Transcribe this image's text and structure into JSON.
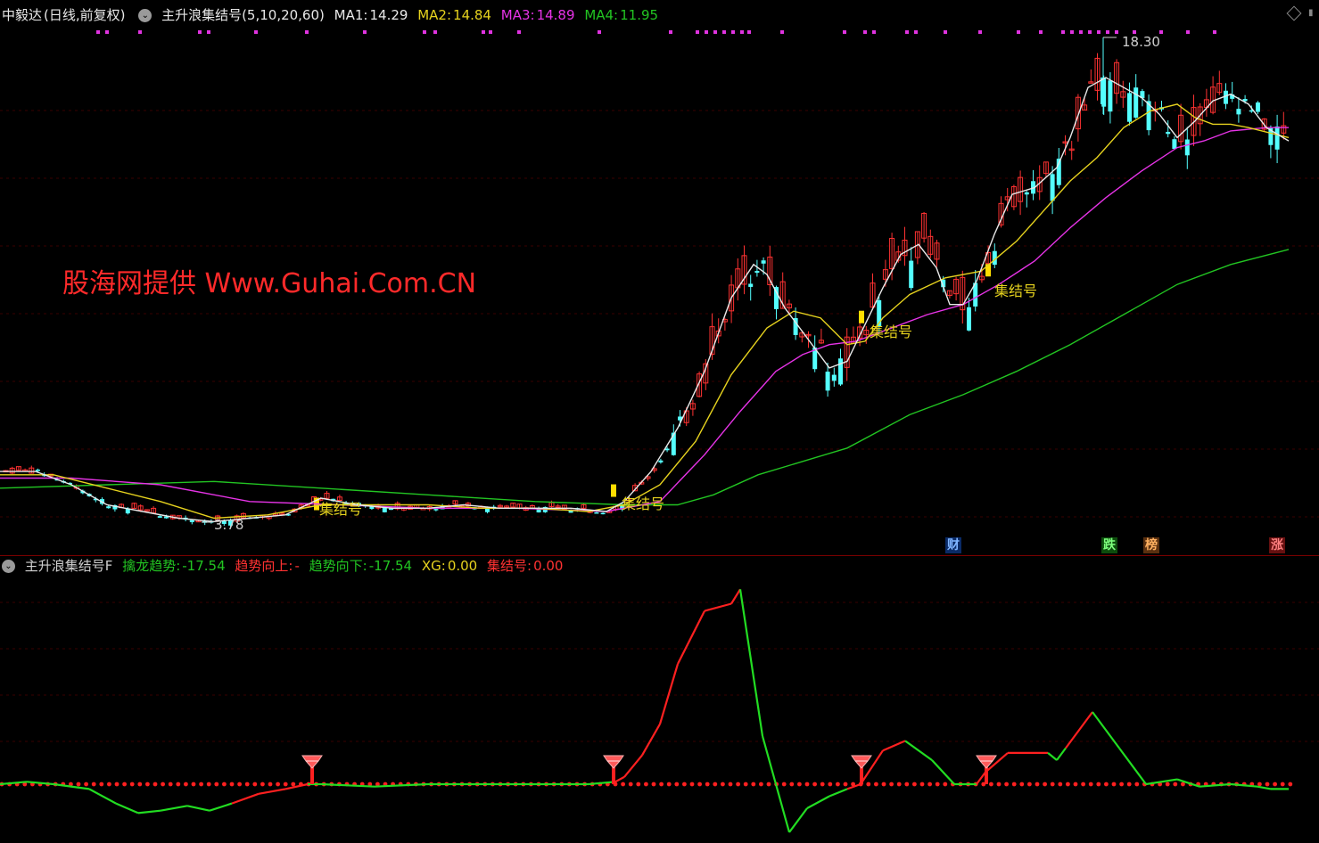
{
  "main_header": {
    "stock": "中毅达",
    "period": "(日线,前复权)",
    "indicator": "主升浪集结号(5,10,20,60)",
    "ma1_label": "MA1:",
    "ma1_val": "14.29",
    "ma2_label": "MA2:",
    "ma2_val": "14.84",
    "ma3_label": "MA3:",
    "ma3_val": "14.89",
    "ma4_label": "MA4:",
    "ma4_val": "11.95"
  },
  "sub_header": {
    "name": "主升浪集结号F",
    "qinlong_label": "擒龙趋势:",
    "qinlong_val": "-17.54",
    "up_label": "趋势向上:",
    "up_val": "-",
    "down_label": "趋势向下:",
    "down_val": "-17.54",
    "xg_label": "XG:",
    "xg_val": "0.00",
    "jjh_label": "集结号:",
    "jjh_val": "0.00"
  },
  "watermark": "股海网提供 Www.Guhai.Com.CN",
  "price_high_label": "18.30",
  "price_low_label": "3.78",
  "signal_label": "集结号",
  "badges": {
    "cai": "财",
    "die": "跌",
    "bang": "榜",
    "zhang": "涨"
  },
  "colors": {
    "up": "#ff3232",
    "down": "#54ffff",
    "ma1": "#e8e8e8",
    "ma2": "#e6d21e",
    "ma3": "#e633e6",
    "ma4": "#22c422",
    "signal": "#ffff33",
    "dots": "#e033e0"
  },
  "chart_data": [
    {
      "type": "candlestick",
      "title": "中毅达 日线 前复权",
      "series_names": [
        "MA1",
        "MA2",
        "MA3",
        "MA4"
      ],
      "last_values": {
        "MA1": 14.29,
        "MA2": 14.84,
        "MA3": 14.89,
        "MA4": 11.95
      },
      "high": 18.3,
      "low": 3.78,
      "ma1": [
        [
          0,
          5.3
        ],
        [
          40,
          5.3
        ],
        [
          80,
          4.9
        ],
        [
          120,
          4.3
        ],
        [
          160,
          4.1
        ],
        [
          200,
          3.9
        ],
        [
          240,
          3.8
        ],
        [
          280,
          3.9
        ],
        [
          320,
          4.0
        ],
        [
          360,
          4.5
        ],
        [
          400,
          4.3
        ],
        [
          440,
          4.2
        ],
        [
          480,
          4.2
        ],
        [
          520,
          4.3
        ],
        [
          560,
          4.2
        ],
        [
          600,
          4.2
        ],
        [
          640,
          4.2
        ],
        [
          680,
          4.1
        ],
        [
          700,
          4.4
        ],
        [
          730,
          5.3
        ],
        [
          760,
          6.6
        ],
        [
          790,
          8.3
        ],
        [
          820,
          10.5
        ],
        [
          845,
          11.5
        ],
        [
          860,
          11.2
        ],
        [
          880,
          10.2
        ],
        [
          905,
          9.3
        ],
        [
          930,
          8.4
        ],
        [
          950,
          8.6
        ],
        [
          970,
          9.7
        ],
        [
          990,
          10.8
        ],
        [
          1010,
          11.8
        ],
        [
          1030,
          12.1
        ],
        [
          1050,
          11.4
        ],
        [
          1065,
          10.3
        ],
        [
          1080,
          10.3
        ],
        [
          1095,
          11.0
        ],
        [
          1115,
          12.4
        ],
        [
          1135,
          13.6
        ],
        [
          1160,
          13.8
        ],
        [
          1185,
          14.4
        ],
        [
          1200,
          15.3
        ],
        [
          1220,
          16.8
        ],
        [
          1240,
          17.1
        ],
        [
          1260,
          16.8
        ],
        [
          1280,
          16.5
        ],
        [
          1300,
          16.0
        ],
        [
          1320,
          15.3
        ],
        [
          1340,
          15.8
        ],
        [
          1360,
          16.4
        ],
        [
          1380,
          16.6
        ],
        [
          1400,
          16.3
        ],
        [
          1420,
          15.6
        ],
        [
          1445,
          15.2
        ]
      ],
      "ma2": [
        [
          0,
          5.2
        ],
        [
          60,
          5.2
        ],
        [
          120,
          4.8
        ],
        [
          180,
          4.4
        ],
        [
          240,
          3.9
        ],
        [
          300,
          4.0
        ],
        [
          360,
          4.3
        ],
        [
          420,
          4.3
        ],
        [
          480,
          4.3
        ],
        [
          540,
          4.2
        ],
        [
          600,
          4.2
        ],
        [
          660,
          4.1
        ],
        [
          700,
          4.3
        ],
        [
          740,
          4.9
        ],
        [
          780,
          6.2
        ],
        [
          820,
          8.2
        ],
        [
          860,
          9.6
        ],
        [
          890,
          10.1
        ],
        [
          920,
          9.9
        ],
        [
          950,
          9.1
        ],
        [
          970,
          9.2
        ],
        [
          990,
          9.9
        ],
        [
          1020,
          10.6
        ],
        [
          1060,
          11.1
        ],
        [
          1100,
          11.3
        ],
        [
          1140,
          12.2
        ],
        [
          1170,
          13.1
        ],
        [
          1200,
          14.0
        ],
        [
          1230,
          14.7
        ],
        [
          1260,
          15.6
        ],
        [
          1290,
          16.1
        ],
        [
          1320,
          16.3
        ],
        [
          1340,
          15.9
        ],
        [
          1360,
          15.7
        ],
        [
          1380,
          15.7
        ],
        [
          1400,
          15.6
        ],
        [
          1445,
          15.3
        ]
      ],
      "ma3": [
        [
          0,
          5.1
        ],
        [
          80,
          5.1
        ],
        [
          180,
          4.9
        ],
        [
          280,
          4.4
        ],
        [
          380,
          4.3
        ],
        [
          480,
          4.2
        ],
        [
          580,
          4.2
        ],
        [
          680,
          4.1
        ],
        [
          740,
          4.4
        ],
        [
          790,
          5.8
        ],
        [
          830,
          7.1
        ],
        [
          870,
          8.3
        ],
        [
          900,
          8.8
        ],
        [
          930,
          9.1
        ],
        [
          960,
          9.2
        ],
        [
          1000,
          9.6
        ],
        [
          1040,
          10.0
        ],
        [
          1080,
          10.3
        ],
        [
          1120,
          10.9
        ],
        [
          1160,
          11.6
        ],
        [
          1200,
          12.6
        ],
        [
          1240,
          13.5
        ],
        [
          1280,
          14.3
        ],
        [
          1320,
          15.0
        ],
        [
          1350,
          15.2
        ],
        [
          1380,
          15.5
        ],
        [
          1420,
          15.6
        ],
        [
          1445,
          15.6
        ]
      ],
      "ma4": [
        [
          0,
          4.8
        ],
        [
          120,
          4.9
        ],
        [
          240,
          5.0
        ],
        [
          360,
          4.8
        ],
        [
          480,
          4.6
        ],
        [
          600,
          4.4
        ],
        [
          700,
          4.3
        ],
        [
          760,
          4.3
        ],
        [
          800,
          4.6
        ],
        [
          850,
          5.2
        ],
        [
          950,
          6.0
        ],
        [
          1020,
          7.0
        ],
        [
          1080,
          7.6
        ],
        [
          1140,
          8.3
        ],
        [
          1200,
          9.1
        ],
        [
          1260,
          10.0
        ],
        [
          1320,
          10.9
        ],
        [
          1380,
          11.5
        ],
        [
          1445,
          11.95
        ]
      ]
    },
    {
      "type": "line",
      "title": "主升浪集结号F",
      "series_names": [
        "擒龙趋势"
      ],
      "last_values": {
        "擒龙趋势": -17.54,
        "XG": 0.0,
        "集结号": 0.0
      },
      "baseline": 0,
      "values": [
        [
          0,
          0
        ],
        [
          30,
          1
        ],
        [
          60,
          0
        ],
        [
          100,
          -2
        ],
        [
          130,
          -8
        ],
        [
          155,
          -12
        ],
        [
          180,
          -11
        ],
        [
          210,
          -9
        ],
        [
          235,
          -11
        ],
        [
          260,
          -8
        ],
        [
          290,
          -4
        ],
        [
          320,
          -2
        ],
        [
          345,
          0
        ],
        [
          360,
          0
        ],
        [
          420,
          -1
        ],
        [
          480,
          0
        ],
        [
          540,
          0
        ],
        [
          600,
          0
        ],
        [
          660,
          0
        ],
        [
          690,
          1
        ],
        [
          700,
          3
        ],
        [
          720,
          12
        ],
        [
          740,
          25
        ],
        [
          760,
          50
        ],
        [
          790,
          72
        ],
        [
          820,
          75
        ],
        [
          830,
          81
        ],
        [
          855,
          20
        ],
        [
          870,
          0
        ],
        [
          885,
          -20
        ],
        [
          905,
          -10
        ],
        [
          930,
          -5
        ],
        [
          950,
          -2
        ],
        [
          965,
          0
        ],
        [
          990,
          14
        ],
        [
          1015,
          18
        ],
        [
          1045,
          10
        ],
        [
          1070,
          0
        ],
        [
          1095,
          0
        ],
        [
          1105,
          5
        ],
        [
          1130,
          13
        ],
        [
          1175,
          13
        ],
        [
          1185,
          10
        ],
        [
          1195,
          15
        ],
        [
          1225,
          30
        ],
        [
          1255,
          15
        ],
        [
          1285,
          0
        ],
        [
          1320,
          2
        ],
        [
          1345,
          -1
        ],
        [
          1380,
          0
        ],
        [
          1410,
          -1
        ],
        [
          1425,
          -2
        ],
        [
          1445,
          -2
        ]
      ],
      "up_ranges": [
        [
          260,
          345
        ],
        [
          690,
          830
        ],
        [
          950,
          1015
        ],
        [
          1095,
          1140
        ],
        [
          1195,
          1225
        ]
      ],
      "signals_x": [
        350,
        688,
        966,
        1106
      ]
    }
  ]
}
